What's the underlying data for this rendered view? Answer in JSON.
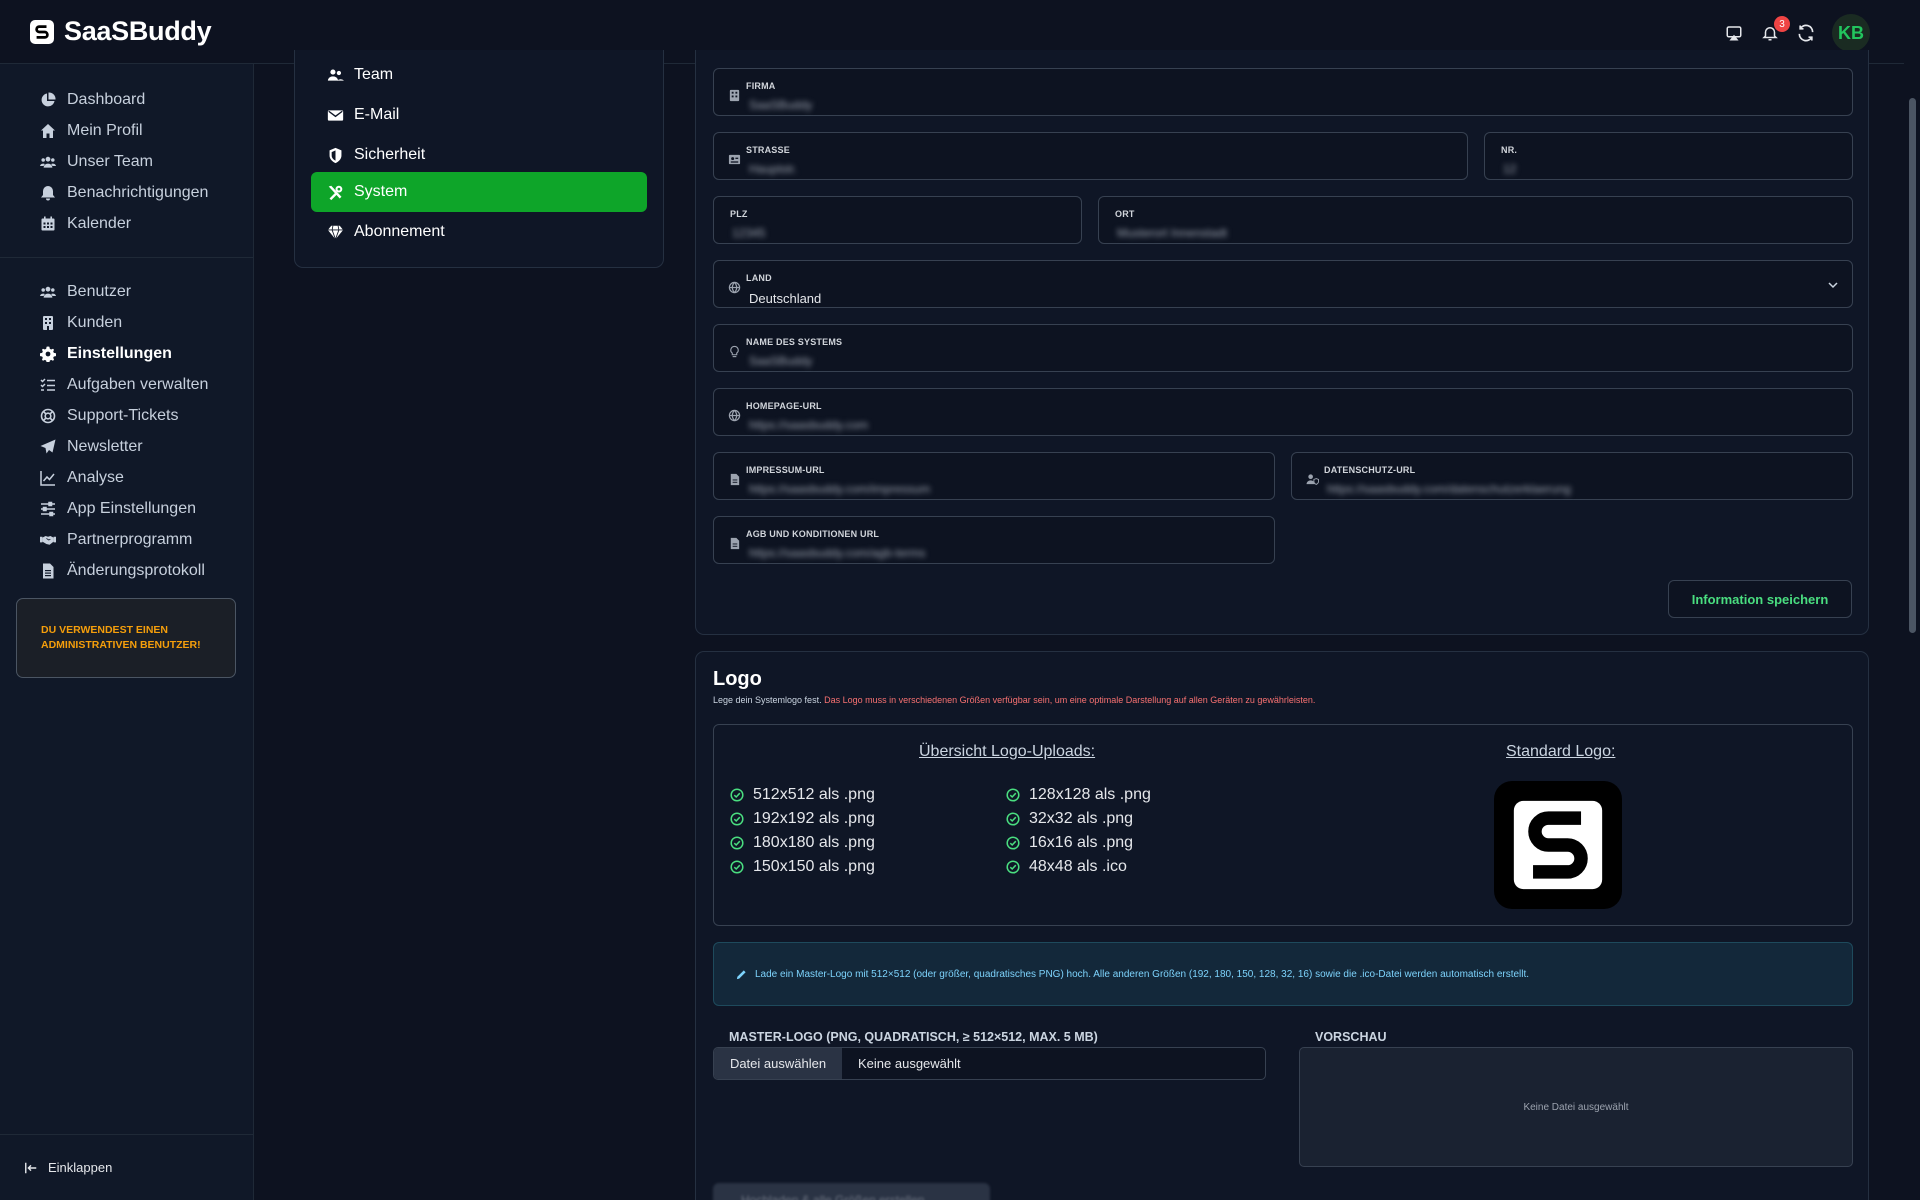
{
  "app": {
    "name": "SaaSBuddy",
    "notification_count": "3",
    "avatar_initials": "KB"
  },
  "sidebar": {
    "group1": [
      {
        "label": "Dashboard",
        "icon": "pie-chart-icon"
      },
      {
        "label": "Mein Profil",
        "icon": "home-icon"
      },
      {
        "label": "Unser Team",
        "icon": "users-icon"
      },
      {
        "label": "Benachrichtigungen",
        "icon": "bell-icon"
      },
      {
        "label": "Kalender",
        "icon": "calendar-icon"
      }
    ],
    "group2": [
      {
        "label": "Benutzer",
        "icon": "users-icon"
      },
      {
        "label": "Kunden",
        "icon": "building-icon"
      },
      {
        "label": "Einstellungen",
        "icon": "gear-icon",
        "active": true
      },
      {
        "label": "Aufgaben verwalten",
        "icon": "list-check-icon"
      },
      {
        "label": "Support-Tickets",
        "icon": "lifebuoy-icon"
      },
      {
        "label": "Newsletter",
        "icon": "paper-plane-icon"
      },
      {
        "label": "Analyse",
        "icon": "line-chart-icon"
      },
      {
        "label": "App Einstellungen",
        "icon": "sliders-icon"
      },
      {
        "label": "Partnerprogramm",
        "icon": "handshake-icon"
      },
      {
        "label": "Änderungsprotokoll",
        "icon": "file-icon"
      }
    ],
    "admin_notice": "DU VERWENDEST EINEN ADMINISTRATIVEN BENUTZER!",
    "collapse_label": "Einklappen"
  },
  "settings_menu": {
    "items": [
      {
        "label": "Team",
        "icon": "users-icon"
      },
      {
        "label": "E-Mail",
        "icon": "envelope-icon"
      },
      {
        "label": "Sicherheit",
        "icon": "shield-icon"
      },
      {
        "label": "System",
        "icon": "tools-icon",
        "active": true
      },
      {
        "label": "Abonnement",
        "icon": "gem-icon"
      }
    ]
  },
  "form": {
    "firma": {
      "label": "FIRMA",
      "value": "SaaSBuddy"
    },
    "strasse": {
      "label": "STRASSE",
      "value": "Hauptstr."
    },
    "nr": {
      "label": "NR.",
      "value": "12"
    },
    "plz": {
      "label": "PLZ",
      "value": "12345"
    },
    "ort": {
      "label": "ORT",
      "value": "Musterort Innenstadt"
    },
    "land": {
      "label": "LAND",
      "value": "Deutschland"
    },
    "system_name": {
      "label": "NAME DES SYSTEMS",
      "value": "SaaSBuddy"
    },
    "homepage": {
      "label": "HOMEPAGE-URL",
      "value": "https://saasbuddy.com"
    },
    "impressum": {
      "label": "IMPRESSUM-URL",
      "value": "https://saasbuddy.com/impressum"
    },
    "datenschutz": {
      "label": "DATENSCHUTZ-URL",
      "value": "https://saasbuddy.com/datenschutzerklaerung"
    },
    "agb": {
      "label": "AGB UND KONDITIONEN URL",
      "value": "https://saasbuddy.com/agb-terms"
    },
    "save_label": "Information speichern"
  },
  "logo": {
    "title": "Logo",
    "subtitle": "Lege dein Systemlogo fest.",
    "subtitle_warning": "Das Logo muss in verschiedenen Größen verfügbar sein, um eine optimale Darstellung auf allen Geräten zu gewährleisten.",
    "overview_title": "Übersicht Logo-Uploads:",
    "standard_title": "Standard Logo:",
    "sizes_left": [
      "512x512 als .png",
      "192x192 als .png",
      "180x180 als .png",
      "150x150 als .png"
    ],
    "sizes_right": [
      "128x128 als .png",
      "32x32 als .png",
      "16x16 als .png",
      "48x48 als .ico"
    ],
    "info": "Lade ein Master-Logo mit 512×512 (oder größer, quadratisches PNG) hoch. Alle anderen Größen (192, 180, 150, 128, 32, 16) sowie die .ico-Datei werden automatisch erstellt.",
    "upload_label": "MASTER-LOGO (PNG, QUADRATISCH, ≥ 512×512, MAX. 5 MB)",
    "file_button": "Datei auswählen",
    "file_none": "Keine ausgewählt",
    "preview_label": "VORSCHAU",
    "preview_empty": "Keine Datei ausgewählt",
    "generate_label": "Hochladen & alle Größen erstellen"
  }
}
